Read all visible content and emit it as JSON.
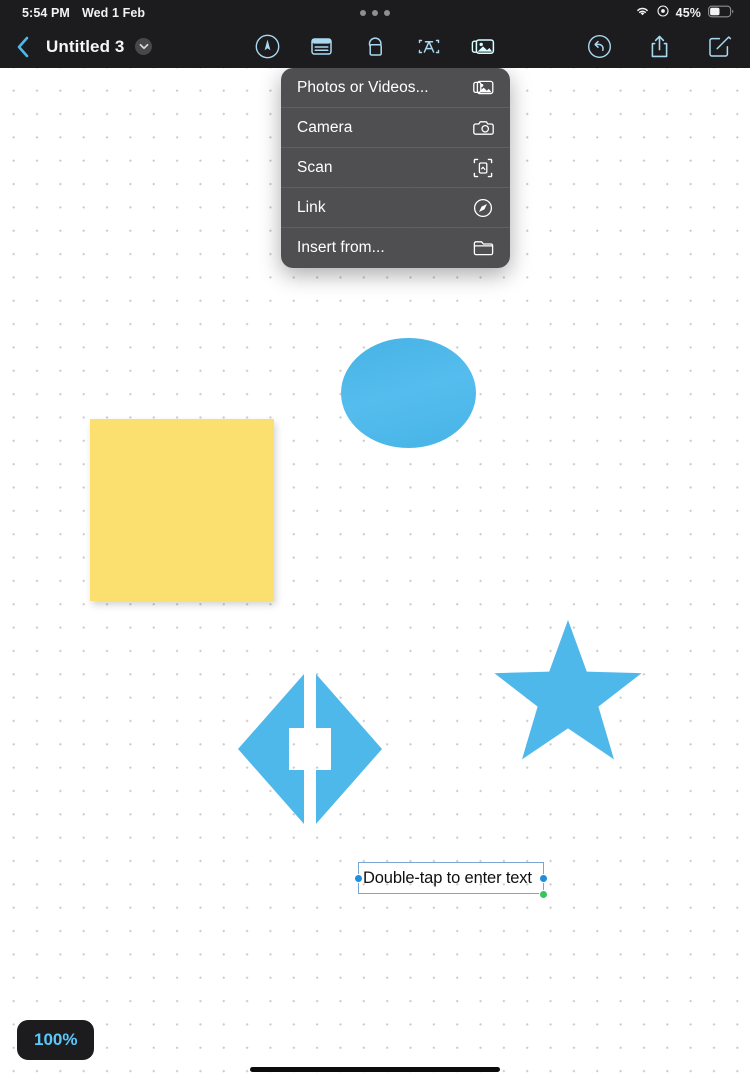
{
  "status_bar": {
    "time": "5:54 PM",
    "date": "Wed 1 Feb",
    "battery_percent": "45%",
    "icons": {
      "wifi": "wifi-icon",
      "control": "target-icon",
      "battery": "battery-icon",
      "multitasking": "multitasking-dots-icon"
    }
  },
  "toolbar": {
    "back_label": "back-chevron-icon",
    "title": "Untitled 3",
    "title_menu_icon": "chevron-down-icon",
    "center_tools": [
      {
        "name": "draw-tool",
        "icon": "pen-circle-icon",
        "active": false
      },
      {
        "name": "table-tool",
        "icon": "table-icon",
        "active": false
      },
      {
        "name": "shapes-tool",
        "icon": "shapes-icon",
        "active": false
      },
      {
        "name": "text-tool",
        "icon": "text-box-a-icon",
        "active": false
      },
      {
        "name": "media-tool",
        "icon": "media-stack-icon",
        "active": true
      }
    ],
    "right_tools": [
      {
        "name": "undo-button",
        "icon": "undo-circle-icon"
      },
      {
        "name": "share-button",
        "icon": "share-icon"
      },
      {
        "name": "compose-button",
        "icon": "compose-icon"
      }
    ]
  },
  "insert_menu": {
    "items": [
      {
        "label": "Photos or Videos...",
        "icon": "photos-icon"
      },
      {
        "label": "Camera",
        "icon": "camera-icon"
      },
      {
        "label": "Scan",
        "icon": "scan-icon"
      },
      {
        "label": "Link",
        "icon": "compass-icon"
      },
      {
        "label": "Insert from...",
        "icon": "folder-icon"
      }
    ]
  },
  "canvas": {
    "zoom_level": "100%",
    "text_box_placeholder": "Double-tap to enter text",
    "shapes": [
      {
        "name": "sticky-note",
        "type": "square",
        "color": "#fbdf6f"
      },
      {
        "name": "circle-shape",
        "type": "circle",
        "color": "#4fb8ea"
      },
      {
        "name": "star-shape",
        "type": "star",
        "color": "#4fb8ea"
      },
      {
        "name": "diamond-arrow-shape",
        "type": "diamond-split-arrow",
        "color": "#4fb8ea"
      }
    ],
    "accent_color": "#4fb8ea",
    "sticky_color": "#fbdf6f",
    "zoom_text_color": "#5ac8fa"
  }
}
